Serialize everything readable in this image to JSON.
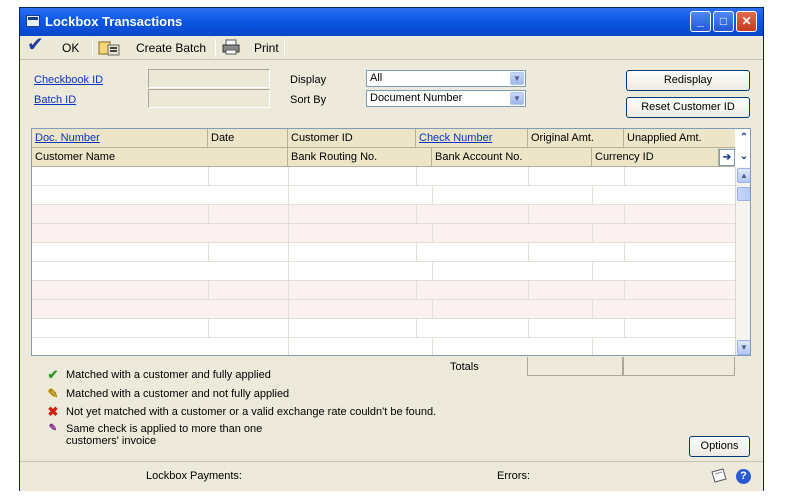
{
  "window": {
    "title": "Lockbox Transactions"
  },
  "toolbar": {
    "ok_label": "OK",
    "create_batch_label": "Create Batch",
    "print_label": "Print"
  },
  "form": {
    "checkbook_id_label": "Checkbook ID",
    "batch_id_label": "Batch ID",
    "checkbook_id_value": "",
    "batch_id_value": "",
    "display_label": "Display",
    "display_value": "All",
    "sort_by_label": "Sort By",
    "sort_by_value": "Document Number",
    "redisplay_label": "Redisplay",
    "reset_customer_label": "Reset Customer ID"
  },
  "grid": {
    "header_row1": [
      "Doc. Number",
      "Date",
      "Customer ID",
      "Check Number",
      "Original Amt.",
      "Unapplied Amt."
    ],
    "header_row2": [
      "Customer Name",
      "Bank Routing No.",
      "Bank Account No.",
      "Currency ID"
    ],
    "totals_label": "Totals"
  },
  "legend": [
    {
      "icon": "checkmark-icon",
      "text": "Matched with a customer and fully applied"
    },
    {
      "icon": "pencil-icon",
      "text": "Matched with a customer and not fully applied"
    },
    {
      "icon": "red-x-icon",
      "text": "Not yet matched with a customer or a valid exchange rate couldn't be found."
    },
    {
      "icon": "multi-apply-icon",
      "text": "Same check is applied to more than one",
      "text2": "customers' invoice"
    }
  ],
  "options_label": "Options",
  "status": {
    "lockbox_payments_label": "Lockbox Payments:",
    "errors_label": "Errors:"
  },
  "colors": {
    "titlebar": "#0c58e6",
    "link": "#0b33c4",
    "grid_header": "#ece5c7"
  }
}
